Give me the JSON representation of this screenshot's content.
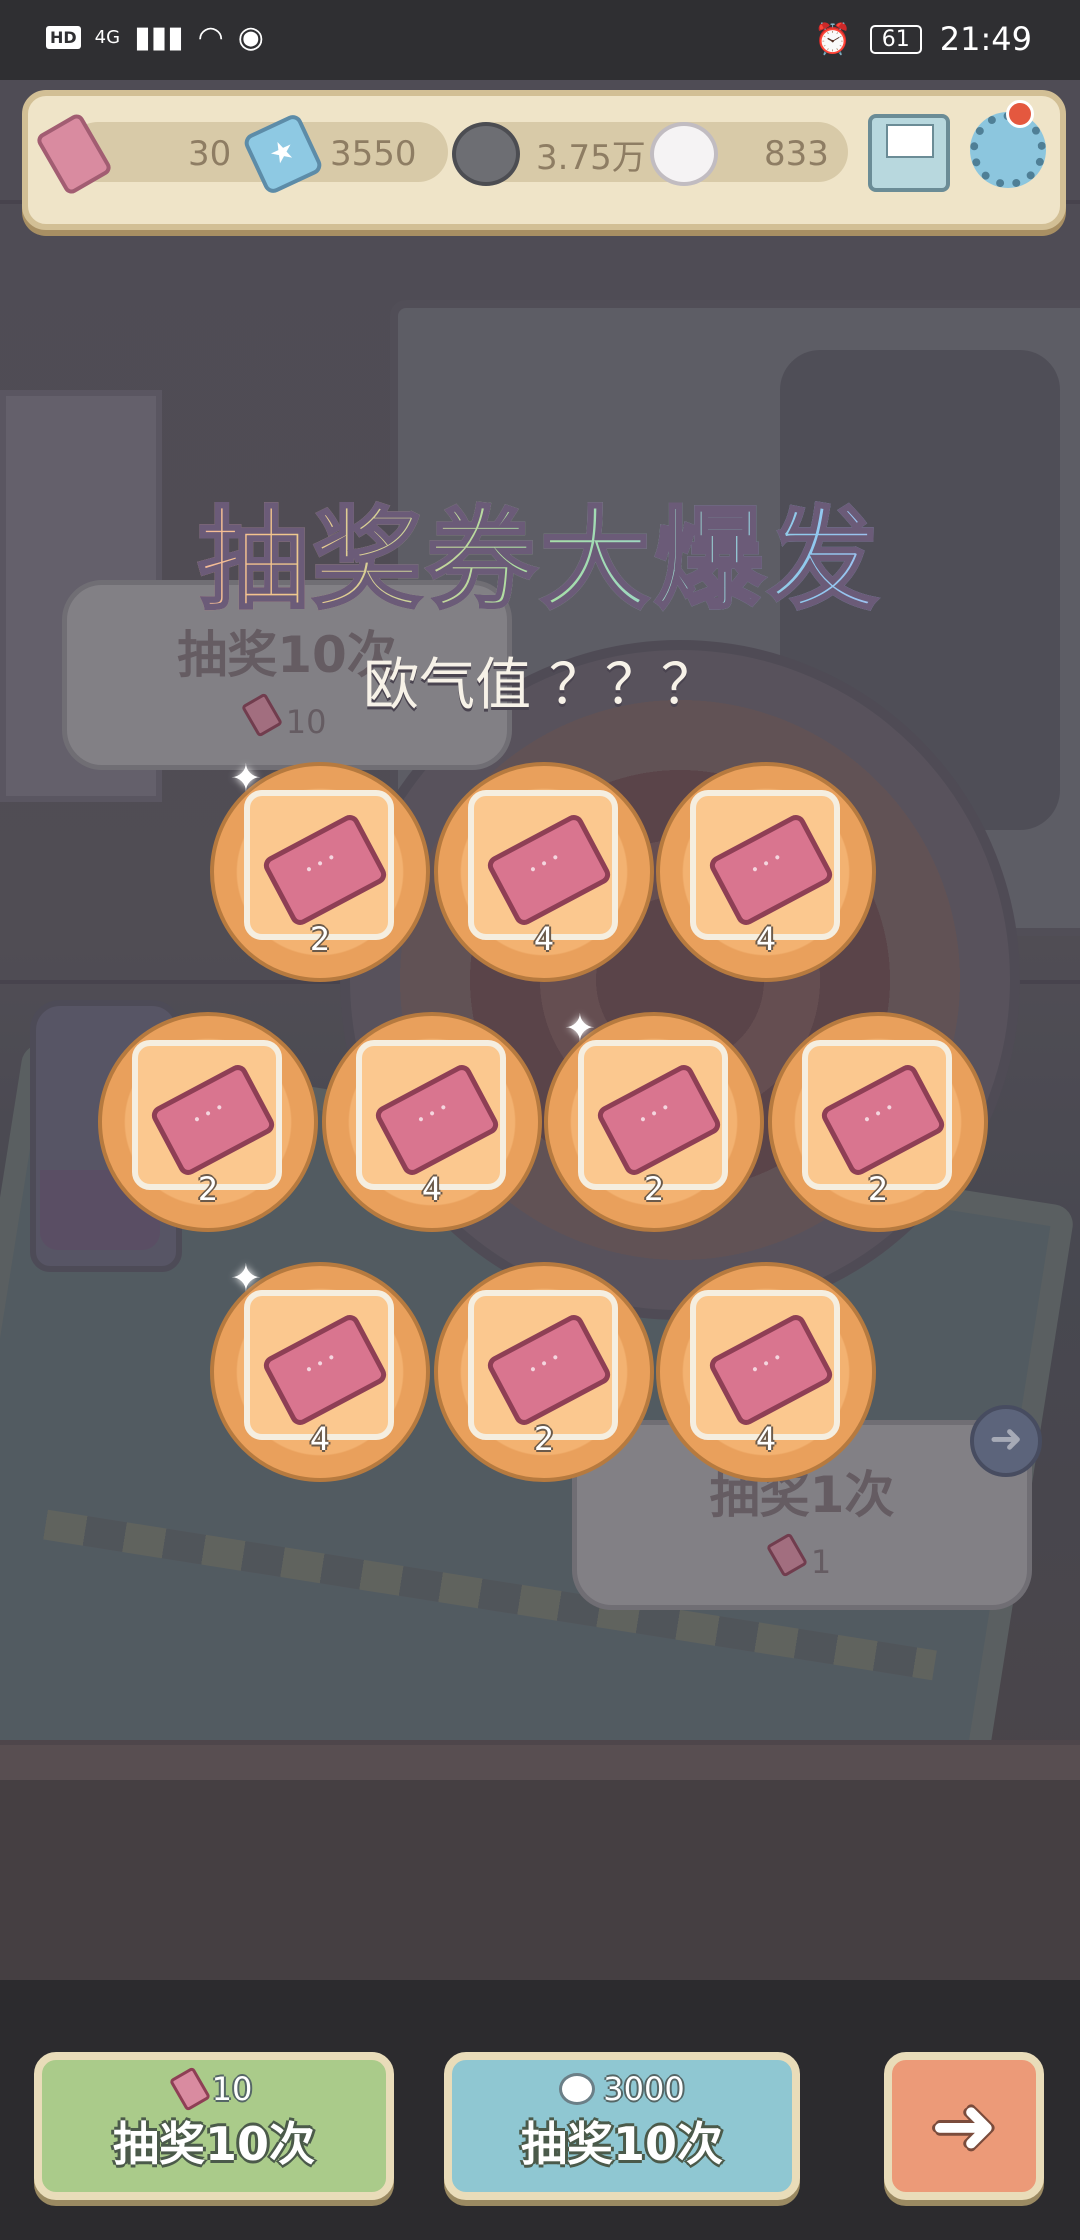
{
  "status_bar": {
    "hd": "HD",
    "network": "4G",
    "battery": "61",
    "time": "21:49"
  },
  "resources": {
    "tickets": "30",
    "star_tickets": "3550",
    "dark_bubbles": "3.75万",
    "light_bubbles": "833"
  },
  "background_signs": {
    "ten_title": "抽奖10次",
    "ten_cost": "10",
    "one_title": "抽奖1次",
    "one_cost": "1"
  },
  "banner": {
    "title": "抽奖券大爆发",
    "luck_label": "欧气值 ？？？"
  },
  "rewards": [
    {
      "count": "2",
      "sparkle": true
    },
    {
      "count": "4",
      "sparkle": false
    },
    {
      "count": "4",
      "sparkle": false
    },
    {
      "count": "2",
      "sparkle": false
    },
    {
      "count": "4",
      "sparkle": false
    },
    {
      "count": "2",
      "sparkle": true
    },
    {
      "count": "2",
      "sparkle": false
    },
    {
      "count": "4",
      "sparkle": true
    },
    {
      "count": "2",
      "sparkle": false
    },
    {
      "count": "4",
      "sparkle": false
    }
  ],
  "buttons": {
    "draw10_ticket_cost": "10",
    "draw10_ticket_label": "抽奖10次",
    "draw10_bubble_cost": "3000",
    "draw10_bubble_label": "抽奖10次",
    "next_icon": "arrow-right-icon"
  },
  "colors": {
    "green_button": "#aacb8a",
    "blue_button": "#8fc7d2",
    "orange_button": "#ec9a78",
    "tile_orange": "#f3b271"
  }
}
